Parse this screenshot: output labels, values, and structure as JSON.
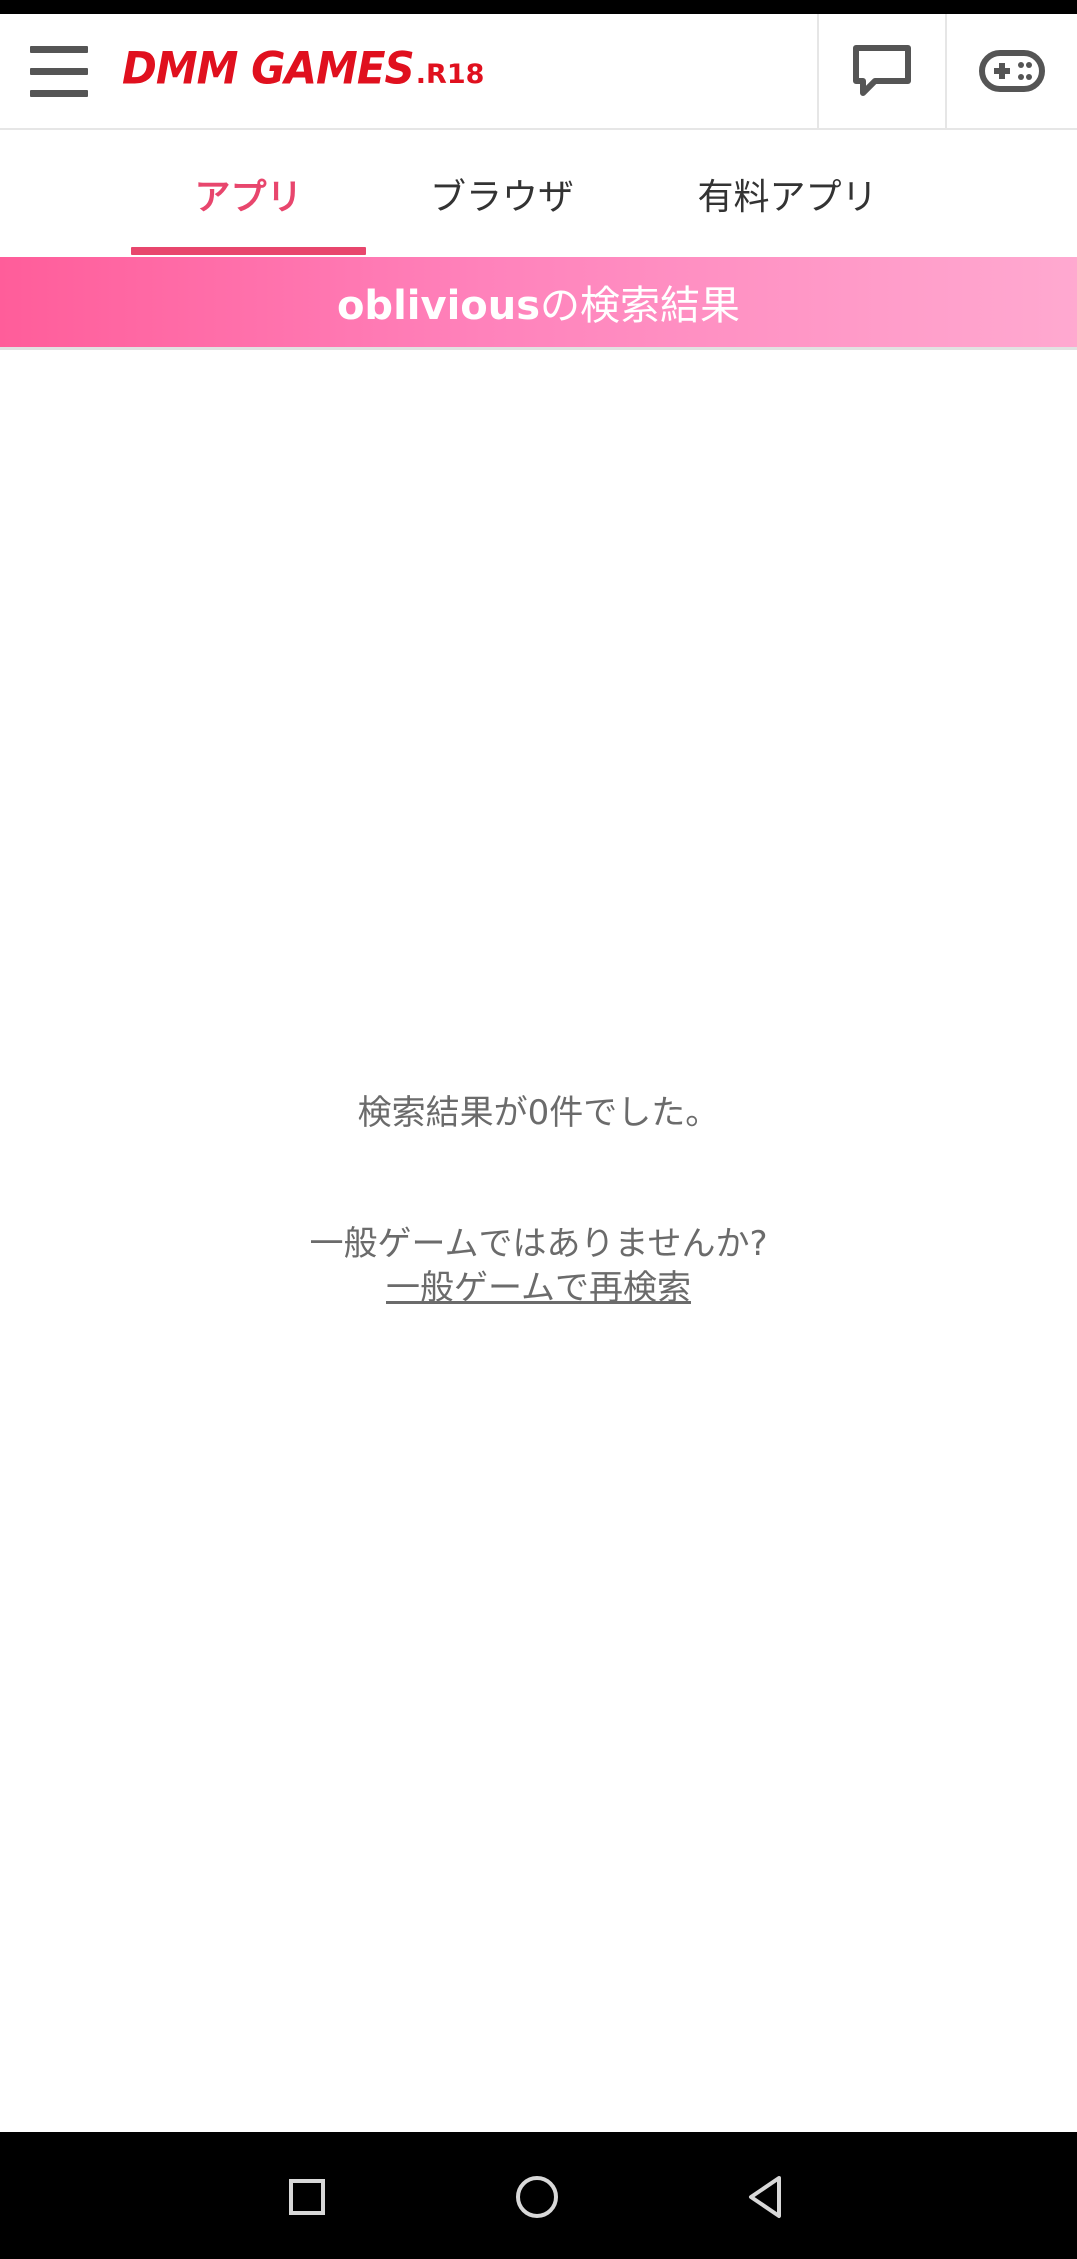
{
  "header": {
    "logo_main": "DMM GAMES",
    "logo_sub": ".R18",
    "icons": {
      "menu": "hamburger-menu-icon",
      "chat": "chat-bubble-icon",
      "gamepad": "gamepad-icon"
    }
  },
  "tabs": [
    {
      "label": "アプリ",
      "active": true
    },
    {
      "label": "ブラウザ",
      "active": false
    },
    {
      "label": "有料アプリ",
      "active": false
    }
  ],
  "banner": {
    "query": "oblivious",
    "suffix": "の検索結果"
  },
  "results": {
    "empty_message": "検索結果が0件でした。",
    "prompt": "一般ゲームではありませんか?",
    "link_label": "一般ゲームで再検索"
  },
  "colors": {
    "brand_red": "#e0101e",
    "accent_pink": "#e8466d",
    "banner_start": "#ff5d9a",
    "banner_end": "#ffa9d0",
    "text_gray": "#6b6b6b"
  },
  "nav_bar": {
    "icons": [
      "recents-square-icon",
      "home-circle-icon",
      "back-triangle-icon"
    ]
  }
}
